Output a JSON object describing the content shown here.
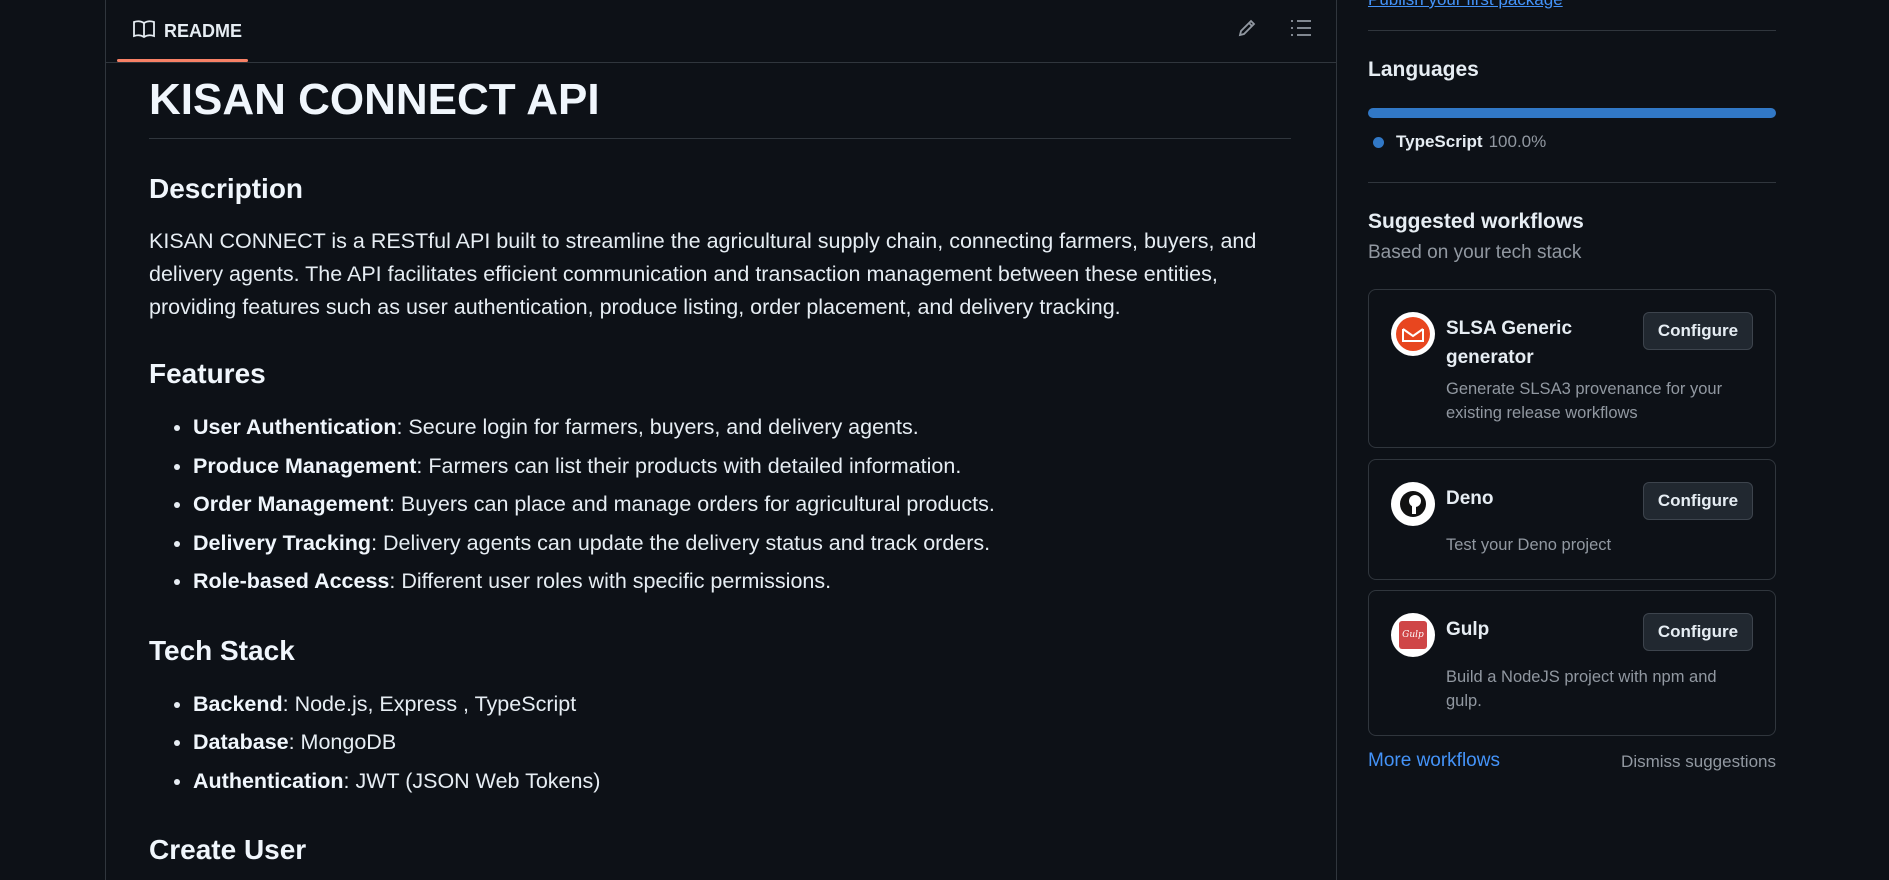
{
  "readme": {
    "tab_label": "README",
    "title": "KISAN CONNECT API",
    "description_heading": "Description",
    "description_text": "KISAN CONNECT is a RESTful API built to streamline the agricultural supply chain, connecting farmers, buyers, and delivery agents. The API facilitates efficient communication and transaction management between these entities, providing features such as user authentication, produce listing, order placement, and delivery tracking.",
    "features_heading": "Features",
    "features": [
      {
        "term": "User Authentication",
        "text": ": Secure login for farmers, buyers, and delivery agents."
      },
      {
        "term": "Produce Management",
        "text": ": Farmers can list their products with detailed information."
      },
      {
        "term": "Order Management",
        "text": ": Buyers can place and manage orders for agricultural products."
      },
      {
        "term": "Delivery Tracking",
        "text": ": Delivery agents can update the delivery status and track orders."
      },
      {
        "term": "Role-based Access",
        "text": ": Different user roles with specific permissions."
      }
    ],
    "techstack_heading": "Tech Stack",
    "techstack": [
      {
        "term": "Backend",
        "text": ": Node.js, Express , TypeScript"
      },
      {
        "term": "Database",
        "text": ": MongoDB"
      },
      {
        "term": "Authentication",
        "text": ": JWT (JSON Web Tokens)"
      }
    ],
    "next_heading": "Create User"
  },
  "sidebar": {
    "publish_link": "Publish your first package",
    "languages_heading": "Languages",
    "language": {
      "name": "TypeScript",
      "percent": "100.0%",
      "share": 1.0,
      "color": "#3178c6"
    },
    "workflows_heading": "Suggested workflows",
    "workflows_subtitle": "Based on your tech stack",
    "workflows": [
      {
        "name": "SLSA Generic generator",
        "description": "Generate SLSA3 provenance for your existing release workflows",
        "button": "Configure",
        "icon": "slsa-icon"
      },
      {
        "name": "Deno",
        "description": "Test your Deno project",
        "button": "Configure",
        "icon": "deno-icon"
      },
      {
        "name": "Gulp",
        "description": "Build a NodeJS project with npm and gulp.",
        "button": "Configure",
        "icon": "gulp-icon",
        "icon_text": "Gulp"
      }
    ],
    "more_workflows": "More workflows",
    "dismiss": "Dismiss suggestions"
  },
  "colors": {
    "background": "#0d1117",
    "border": "#30363d",
    "accent": "#f78166",
    "link": "#4493f8"
  }
}
